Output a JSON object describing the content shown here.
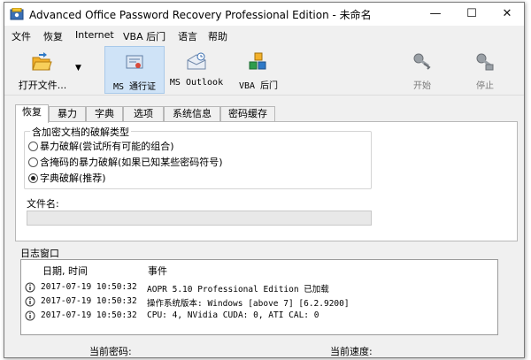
{
  "window": {
    "title": "Advanced Office Password Recovery Professional Edition - 未命名",
    "controls": {
      "minimize": "—",
      "maximize": "☐",
      "close": "✕"
    }
  },
  "menu": [
    "文件",
    "恢复",
    "Internet",
    "VBA 后门",
    "语言",
    "帮助"
  ],
  "toolbar": {
    "open": {
      "label": "打开文件...",
      "icon": "folder-open-icon"
    },
    "ms_cert": {
      "label": "MS 通行证",
      "icon": "certificate-icon"
    },
    "ms_outlook": {
      "label": "MS Outlook",
      "icon": "outlook-icon"
    },
    "vba": {
      "label": "VBA 后门",
      "icon": "vba-cubes-icon"
    },
    "start": {
      "label": "开始",
      "icon": "key-start-icon"
    },
    "stop": {
      "label": "停止",
      "icon": "key-stop-icon"
    }
  },
  "tabs": [
    "恢复",
    "暴力",
    "字典",
    "选项",
    "系统信息",
    "密码缓存"
  ],
  "recovery": {
    "group_title": "含加密文档的破解类型",
    "options": [
      {
        "label": "暴力破解(尝试所有可能的组合)",
        "selected": false
      },
      {
        "label": "含掩码的暴力破解(如果已知某些密码符号)",
        "selected": false
      },
      {
        "label": "字典破解(推荐)",
        "selected": true
      }
    ],
    "file_label": "文件名:",
    "file_value": ""
  },
  "log": {
    "title": "日志窗口",
    "headers": {
      "datetime": "日期, 时间",
      "event": "事件"
    },
    "rows": [
      {
        "datetime": "2017-07-19 10:50:32",
        "event": "AOPR 5.10 Professional Edition 已加载"
      },
      {
        "datetime": "2017-07-19 10:50:32",
        "event": "操作系统版本: Windows [above 7] [6.2.9200]"
      },
      {
        "datetime": "2017-07-19 10:50:32",
        "event": "CPU: 4, NVidia CUDA: 0, ATI CAL: 0"
      }
    ]
  },
  "status": {
    "current_password": "当前密码:",
    "current_speed": "当前速度:"
  },
  "colors": {
    "accent": "#cfe3f7",
    "folder": "#f3b12b",
    "arrow": "#2e79c7"
  }
}
